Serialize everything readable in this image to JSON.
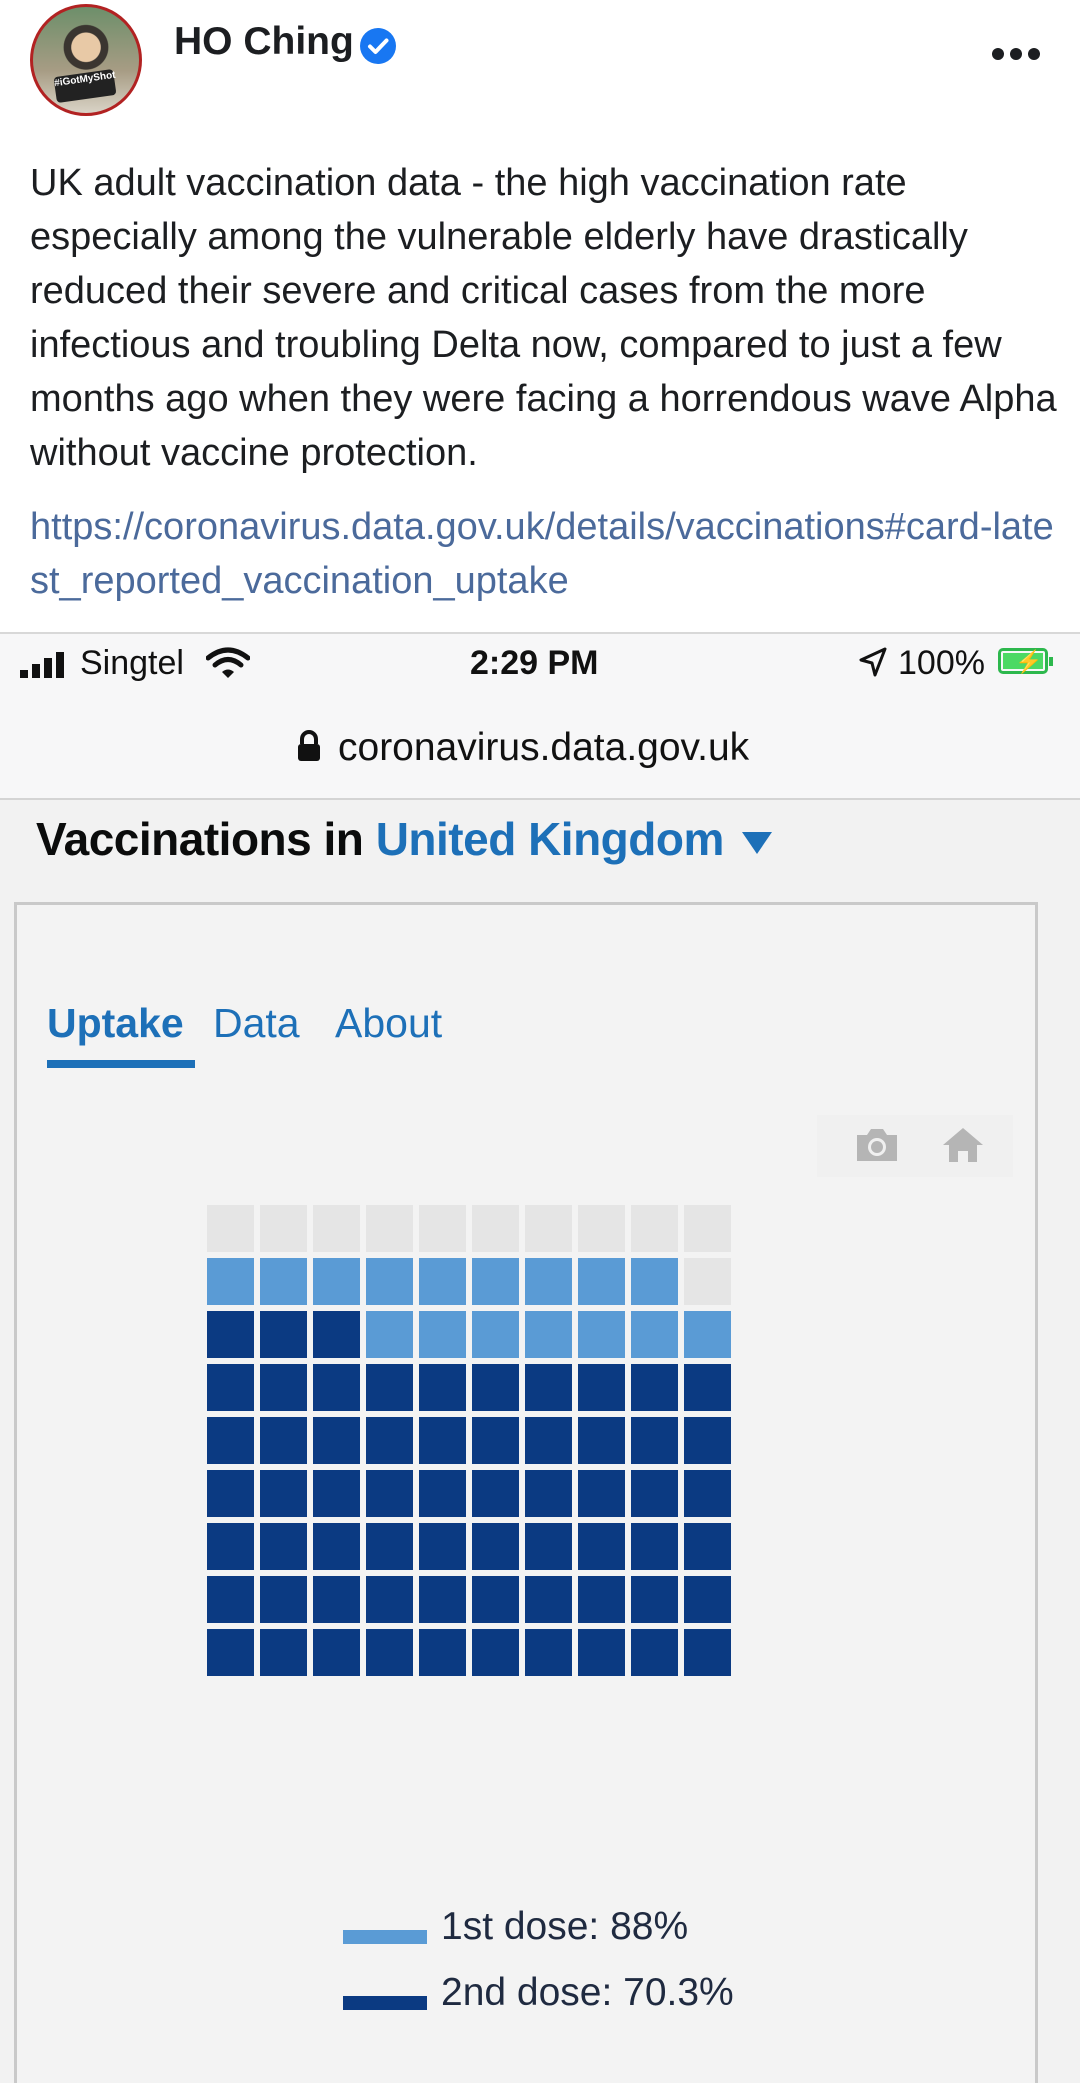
{
  "post": {
    "author": "HO Ching",
    "avatar_badge": "#iGotMyShot",
    "text": "UK adult vaccination data - the high vaccination rate especially among the vulnerable elderly have drastically reduced their severe and critical cases from the more infectious and troubling Delta now, compared to just a few months ago when they were facing a horrendous wave Alpha without vaccine protection.",
    "link": "https://coronavirus.data.gov.uk/details/vaccinations#card-latest_reported_vaccination_uptake"
  },
  "screenshot": {
    "status_bar": {
      "carrier": "Singtel",
      "time": "2:29 PM",
      "battery": "100%"
    },
    "url": "coronavirus.data.gov.uk",
    "heading": {
      "prefix": "Vaccinations in",
      "location": "United Kingdom"
    },
    "tabs": [
      {
        "label": "Uptake",
        "active": true
      },
      {
        "label": "Data",
        "active": false
      },
      {
        "label": "About",
        "active": false
      }
    ]
  },
  "chart_data": {
    "type": "waffle",
    "grid": {
      "rows": 9,
      "cols": 10
    },
    "series": [
      {
        "name": "1st dose",
        "value": 88,
        "label": "1st dose: 88%",
        "color": "#5a9bd5"
      },
      {
        "name": "2nd dose",
        "value": 70.3,
        "label": "2nd dose: 70.3%",
        "color": "#0b3a82"
      }
    ],
    "unfilled_color": "#e5e5e5"
  },
  "colors": {
    "link": "#4b6a9b",
    "verified": "#1877f2",
    "gov_blue": "#1d70b8"
  }
}
